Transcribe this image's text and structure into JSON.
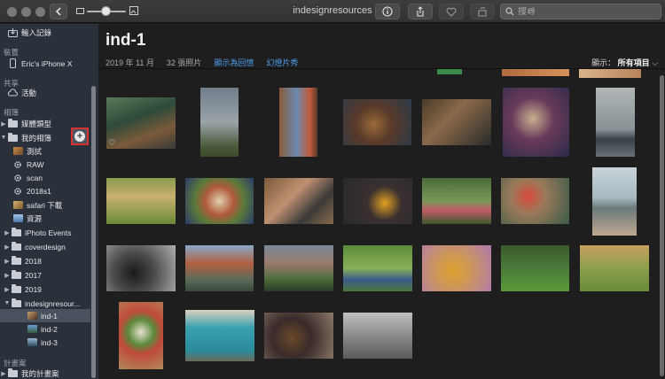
{
  "toolbar": {
    "title": "indesignresources",
    "search_placeholder": "搜尋",
    "back_icon": "chevron-left-icon",
    "info_icon": "info-icon",
    "share_icon": "share-icon",
    "favorite_icon": "heart-icon",
    "rotate_icon": "rotate-icon",
    "search_icon": "search-icon"
  },
  "sidebar": {
    "import_label": "輸入記錄",
    "devices_header": "裝置",
    "device_label": "Eric's iPhone X",
    "shared_header": "共享",
    "activity_label": "活動",
    "albums_header": "相簿",
    "media_types_label": "媒體類型",
    "my_albums_label": "我的相簿",
    "albums": [
      {
        "label": "測試"
      },
      {
        "label": "RAW"
      },
      {
        "label": "scan"
      },
      {
        "label": "2018s1"
      },
      {
        "label": "safari 下載"
      },
      {
        "label": "資源"
      }
    ],
    "folders": [
      {
        "label": "iPhoto Events"
      },
      {
        "label": "coverdesign"
      },
      {
        "label": "2018"
      },
      {
        "label": "2017"
      },
      {
        "label": "2019"
      },
      {
        "label": "indesignresour..."
      }
    ],
    "sub_albums": [
      {
        "label": "ind-1"
      },
      {
        "label": "ind-2"
      },
      {
        "label": "ind-3"
      }
    ],
    "projects_header": "計畫案",
    "my_projects_label": "我的計畫案"
  },
  "main": {
    "title": "ind-1",
    "date": "2019 年 11 月",
    "count": "32 張照片",
    "show_as_memory": "顯示為回憶",
    "slideshow": "幻燈片秀",
    "display_label": "顯示：",
    "display_value": "所有項目"
  },
  "colors": {
    "sidebar_bg": "#2b313a",
    "main_bg": "#1e1e1e",
    "accent_link": "#4d9bea",
    "selection": "#4a5260",
    "highlight_border": "#d7322e"
  }
}
